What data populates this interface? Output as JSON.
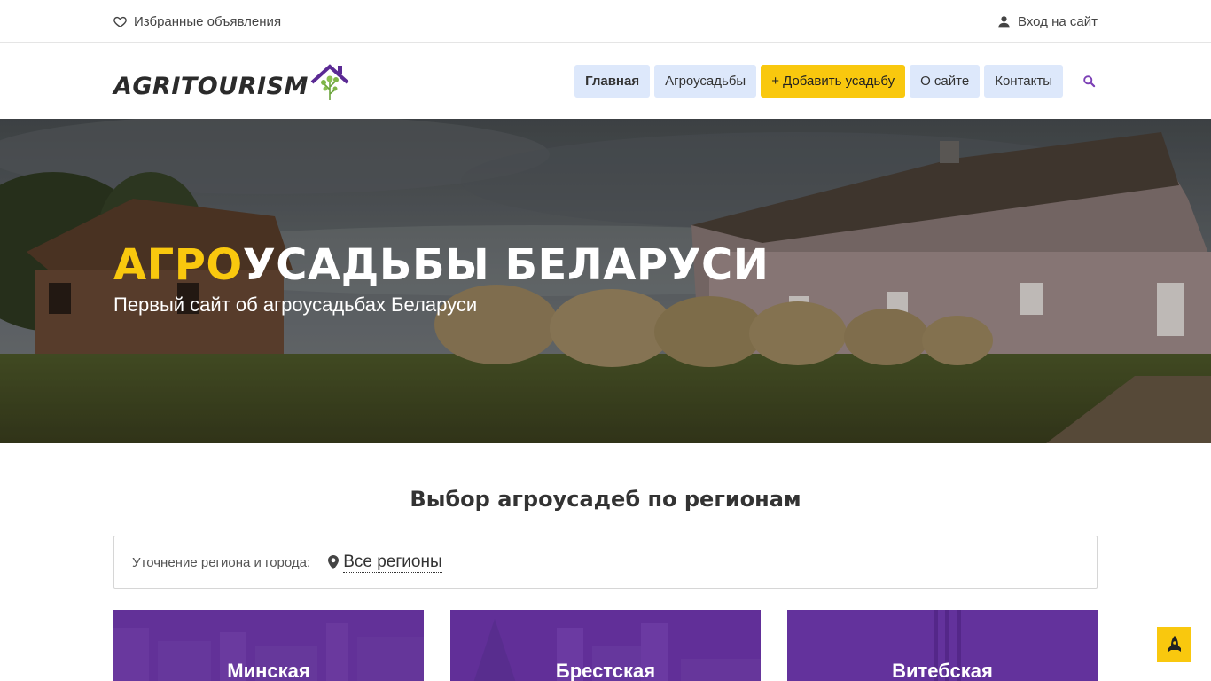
{
  "topbar": {
    "favorites_label": "Избранные объявления",
    "login_label": "Вход на сайт"
  },
  "header": {
    "logo_text": "AGRITOURISM",
    "nav": [
      {
        "label": "Главная"
      },
      {
        "label": "Агроусадьбы"
      },
      {
        "label": "+ Добавить усадьбу"
      },
      {
        "label": "О сайте"
      },
      {
        "label": "Контакты"
      }
    ]
  },
  "hero": {
    "title_accent": "АГРО",
    "title_rest": "УСАДЬБЫ БЕЛАРУСИ",
    "subtitle": "Первый сайт об агроусадьбах Беларуси"
  },
  "regions": {
    "title": "Выбор агроусадеб по регионам",
    "filter_label": "Уточнение региона и города:",
    "filter_value": "Все регионы",
    "cards": [
      {
        "label": "Минская"
      },
      {
        "label": "Брестская"
      },
      {
        "label": "Витебская"
      }
    ]
  },
  "colors": {
    "accent": "#f9c80e",
    "nav_bg": "#dde8fb",
    "card_overlay": "#5b2a94",
    "search_icon": "#7b3fb5"
  },
  "icons": {
    "favorites": "heart-outline-icon",
    "login": "user-icon",
    "search": "search-icon",
    "location": "map-marker-icon",
    "to_top": "rocket-icon"
  }
}
